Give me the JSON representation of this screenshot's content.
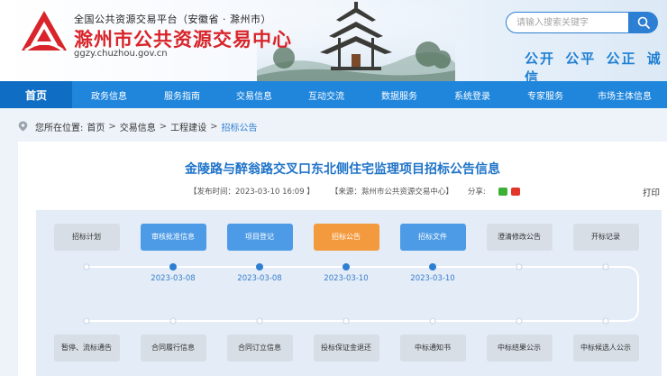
{
  "header": {
    "platform_line": "全国公共资源交易平台（安徽省 · 滁州市）",
    "site_name": "滁州市公共资源交易中心",
    "domain": "ggzy.chuzhou.gov.cn",
    "search_placeholder": "请输入搜索关键字",
    "slogan": "公开  公平  公正  诚信"
  },
  "nav": {
    "items": [
      {
        "label": "首页",
        "active": true
      },
      {
        "label": "政务信息"
      },
      {
        "label": "服务指南"
      },
      {
        "label": "交易信息"
      },
      {
        "label": "互动交流"
      },
      {
        "label": "数据服务"
      },
      {
        "label": "系统登录"
      },
      {
        "label": "专家服务"
      },
      {
        "label": "市场主体信息"
      }
    ]
  },
  "breadcrumb": {
    "prefix": "您所在位置:",
    "items": [
      "首页",
      "交易信息",
      "工程建设",
      "招标公告"
    ],
    "separator": ">"
  },
  "article": {
    "title": "金陵路与醉翁路交叉口东北侧住宅监理项目招标公告信息",
    "publish_time": "【发布时间：2023-03-10 16:09 】",
    "source": "【来源：滁州市公共资源交易中心】",
    "share_label": "分享:",
    "print_label": "打印"
  },
  "flow": {
    "top_steps": [
      {
        "label": "招标计划",
        "style": "grey"
      },
      {
        "label": "审核批准信息",
        "style": "blue"
      },
      {
        "label": "项目登记",
        "style": "blue"
      },
      {
        "label": "招标公告",
        "style": "orange"
      },
      {
        "label": "招标文件",
        "style": "blue"
      },
      {
        "label": "澄清修改公告",
        "style": "grey"
      },
      {
        "label": "开标记录",
        "style": "grey"
      }
    ],
    "dates": [
      "2023-03-08",
      "2023-03-08",
      "2023-03-10",
      "2023-03-10"
    ],
    "bottom_steps": [
      {
        "label": "暂停、流标通告",
        "style": "grey"
      },
      {
        "label": "合同履行信息",
        "style": "grey"
      },
      {
        "label": "合同订立信息",
        "style": "grey"
      },
      {
        "label": "投标保证金退还",
        "style": "grey"
      },
      {
        "label": "中标通知书",
        "style": "grey"
      },
      {
        "label": "中标结果公示",
        "style": "grey"
      },
      {
        "label": "中标候选人公示",
        "style": "grey"
      }
    ]
  },
  "colors": {
    "brand_red": "#d8242a",
    "nav_blue": "#1f86dc",
    "link_blue": "#2d7fd3",
    "active_orange": "#f49a3e"
  }
}
